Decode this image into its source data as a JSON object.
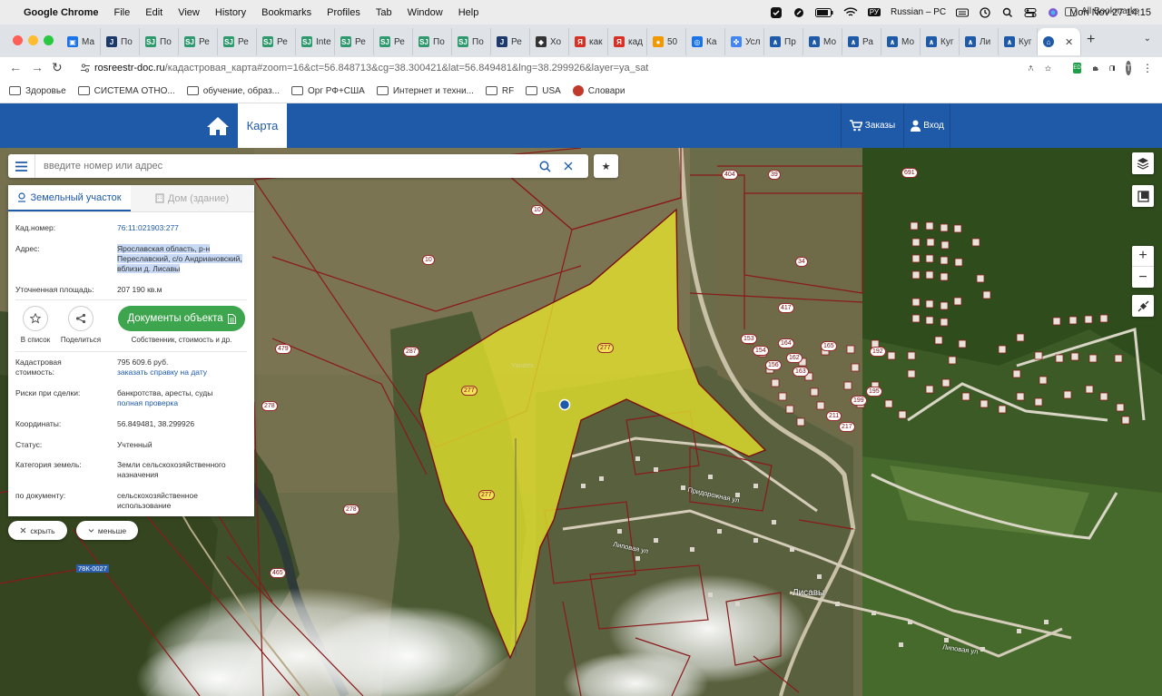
{
  "menubar": {
    "app": "Google Chrome",
    "items": [
      "File",
      "Edit",
      "View",
      "History",
      "Bookmarks",
      "Profiles",
      "Tab",
      "Window",
      "Help"
    ],
    "input_source": "Russian – PC",
    "clock": "Mon Nov 27  14:15"
  },
  "tabs": [
    {
      "label": "Ма",
      "color": "#1a73e8",
      "glyph": "▣"
    },
    {
      "label": "По",
      "color": "#1b3a6b",
      "glyph": "J"
    },
    {
      "label": "По",
      "color": "#2f9a6e",
      "glyph": "SJ"
    },
    {
      "label": "Ре",
      "color": "#2f9a6e",
      "glyph": "SJ"
    },
    {
      "label": "Ре",
      "color": "#2f9a6e",
      "glyph": "SJ"
    },
    {
      "label": "Ре",
      "color": "#2f9a6e",
      "glyph": "SJ"
    },
    {
      "label": "Inte",
      "color": "#2f9a6e",
      "glyph": "SJ"
    },
    {
      "label": "Ре",
      "color": "#2f9a6e",
      "glyph": "SJ"
    },
    {
      "label": "Ре",
      "color": "#2f9a6e",
      "glyph": "SJ"
    },
    {
      "label": "По",
      "color": "#2f9a6e",
      "glyph": "SJ"
    },
    {
      "label": "По",
      "color": "#2f9a6e",
      "glyph": "SJ"
    },
    {
      "label": "Ре",
      "color": "#1b3a6b",
      "glyph": "J"
    },
    {
      "label": "Хо",
      "color": "#333333",
      "glyph": "◆"
    },
    {
      "label": "как",
      "color": "#d93025",
      "glyph": "Я"
    },
    {
      "label": "кад",
      "color": "#d93025",
      "glyph": "Я"
    },
    {
      "label": "50",
      "color": "#f29900",
      "glyph": "●"
    },
    {
      "label": "Ка",
      "color": "#1a73e8",
      "glyph": "◎"
    },
    {
      "label": "Усл",
      "color": "#4285f4",
      "glyph": "✤"
    },
    {
      "label": "Пр",
      "color": "#1e5aa8",
      "glyph": "∧"
    },
    {
      "label": "Мо",
      "color": "#1e5aa8",
      "glyph": "∧"
    },
    {
      "label": "Ра",
      "color": "#1e5aa8",
      "glyph": "∧"
    },
    {
      "label": "Мо",
      "color": "#1e5aa8",
      "glyph": "∧"
    },
    {
      "label": "Куг",
      "color": "#1e5aa8",
      "glyph": "∧"
    },
    {
      "label": "Ли",
      "color": "#1e5aa8",
      "glyph": "∧"
    },
    {
      "label": "Куг",
      "color": "#1e5aa8",
      "glyph": "∧"
    }
  ],
  "url": {
    "host": "rosreestr-doc.ru",
    "path": "/кадастровая_карта#zoom=16&ct=56.848713&cg=38.300421&lat=56.849481&lng=38.299926&layer=ya_sat"
  },
  "bookmarks": [
    {
      "label": "Здоровье",
      "kind": "folder"
    },
    {
      "label": "СИСТЕМА ОТНО...",
      "kind": "folder"
    },
    {
      "label": "обучение, образ...",
      "kind": "folder"
    },
    {
      "label": "Орг РФ+США",
      "kind": "folder"
    },
    {
      "label": "Интернет и техни...",
      "kind": "folder"
    },
    {
      "label": "RF",
      "kind": "folder"
    },
    {
      "label": "USA",
      "kind": "folder"
    },
    {
      "label": "Словари",
      "kind": "site"
    }
  ],
  "all_bookmarks": "All Bookmarks",
  "header": {
    "map_tab": "Карта",
    "orders": "Заказы",
    "login": "Вход"
  },
  "search": {
    "placeholder": "введите номер или адрес"
  },
  "panel": {
    "tab_land": "Земельный участок",
    "tab_building": "Дом (здание)",
    "cad_num_label": "Кад.номер:",
    "cad_num": "76:11:021903:277",
    "address_label": "Адрес:",
    "address": "Ярославская область, р-н Переславский, с/о Андриановский, вблизи д. Лисавы",
    "area_label": "Уточненная площадь:",
    "area": "207 190 кв.м",
    "to_list": "В список",
    "share": "Поделиться",
    "docs_button": "Документы объекта",
    "docs_caption": "Собственник, стоимость и др.",
    "cost_label": "Кадастровая стоимость:",
    "cost": "795 609.6 руб.",
    "cost_link": "заказать справку на дату",
    "risks_label": "Риски при сделки:",
    "risks": "банкротства, аресты, суды",
    "risks_link": "полная проверка",
    "coords_label": "Координаты:",
    "coords": "56.849481, 38.299926",
    "status_label": "Статус:",
    "status": "Учтенный",
    "category_label": "Категория земель:",
    "category": "Земли сельскохозяйственного назначения",
    "doc_label": "по документу:",
    "doc": "сельскохозяйственное использование"
  },
  "hide_btn": "скрыть",
  "less_btn": "меньше",
  "map_labels": {
    "village": "Лисавы",
    "street1": "Придорожная ул",
    "street2": "Липовая ул",
    "road": "78К-0027",
    "yandex": "Yandex"
  },
  "parcel_numbers": [
    "10",
    "10",
    "404",
    "39",
    "691",
    "34",
    "417",
    "277",
    "277",
    "277",
    "287",
    "479",
    "278",
    "278",
    "465",
    "153",
    "164",
    "165",
    "154",
    "162",
    "156",
    "163",
    "192",
    "195",
    "199",
    "217",
    "211"
  ]
}
